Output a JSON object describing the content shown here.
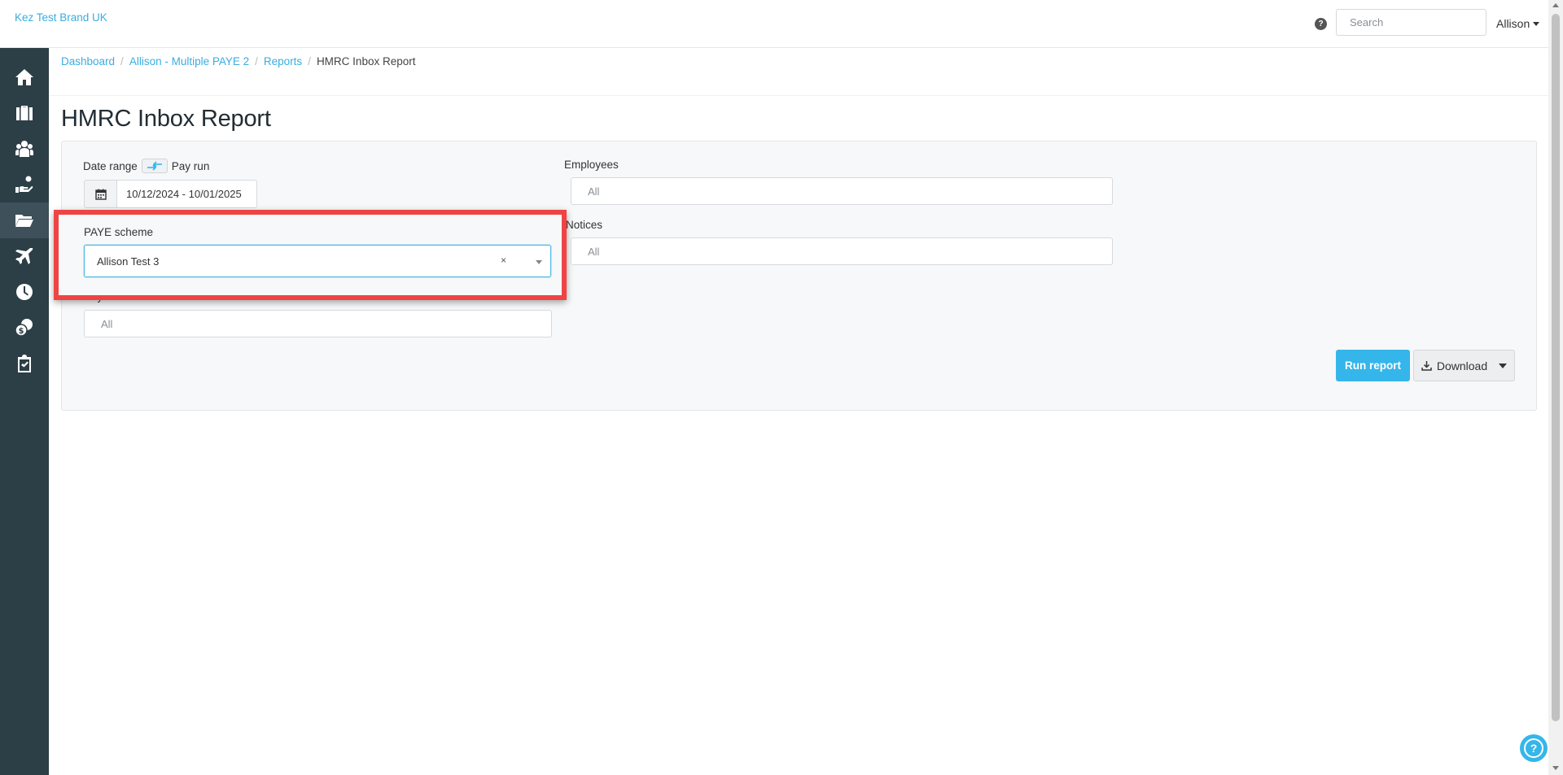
{
  "header": {
    "brand": "Kez Test Brand UK",
    "help_icon_label": "?",
    "search_placeholder": "Search",
    "user_name": "Allison"
  },
  "sidebar": {
    "items": [
      {
        "icon": "home-icon"
      },
      {
        "icon": "briefcase-icon"
      },
      {
        "icon": "employees-icon"
      },
      {
        "icon": "payments-icon"
      },
      {
        "icon": "folder-icon",
        "active": true
      },
      {
        "icon": "plane-icon"
      },
      {
        "icon": "clock-icon"
      },
      {
        "icon": "coins-icon"
      },
      {
        "icon": "clipboard-check-icon"
      }
    ]
  },
  "breadcrumb": {
    "items": [
      "Dashboard",
      "Allison - Multiple PAYE 2",
      "Reports"
    ],
    "current": "HMRC Inbox Report"
  },
  "page": {
    "title": "HMRC Inbox Report"
  },
  "form": {
    "date_range_label": "Date range",
    "pay_run_label": "Pay run",
    "date_range_value": "10/12/2024 - 10/01/2025",
    "paye_scheme_label": "PAYE scheme",
    "paye_scheme_value": "Allison Test 3",
    "paye_clear": "×",
    "pay_schedule_label": "Pay schedule",
    "pay_schedule_value": "All",
    "employees_label": "Employees",
    "employees_value": "All",
    "notices_label": "Notices",
    "notices_value": "All"
  },
  "actions": {
    "run_report": "Run report",
    "download": "Download"
  },
  "colors": {
    "accent": "#35b6ea",
    "sidebar": "#2c3e46",
    "highlight": "#ef4444"
  }
}
